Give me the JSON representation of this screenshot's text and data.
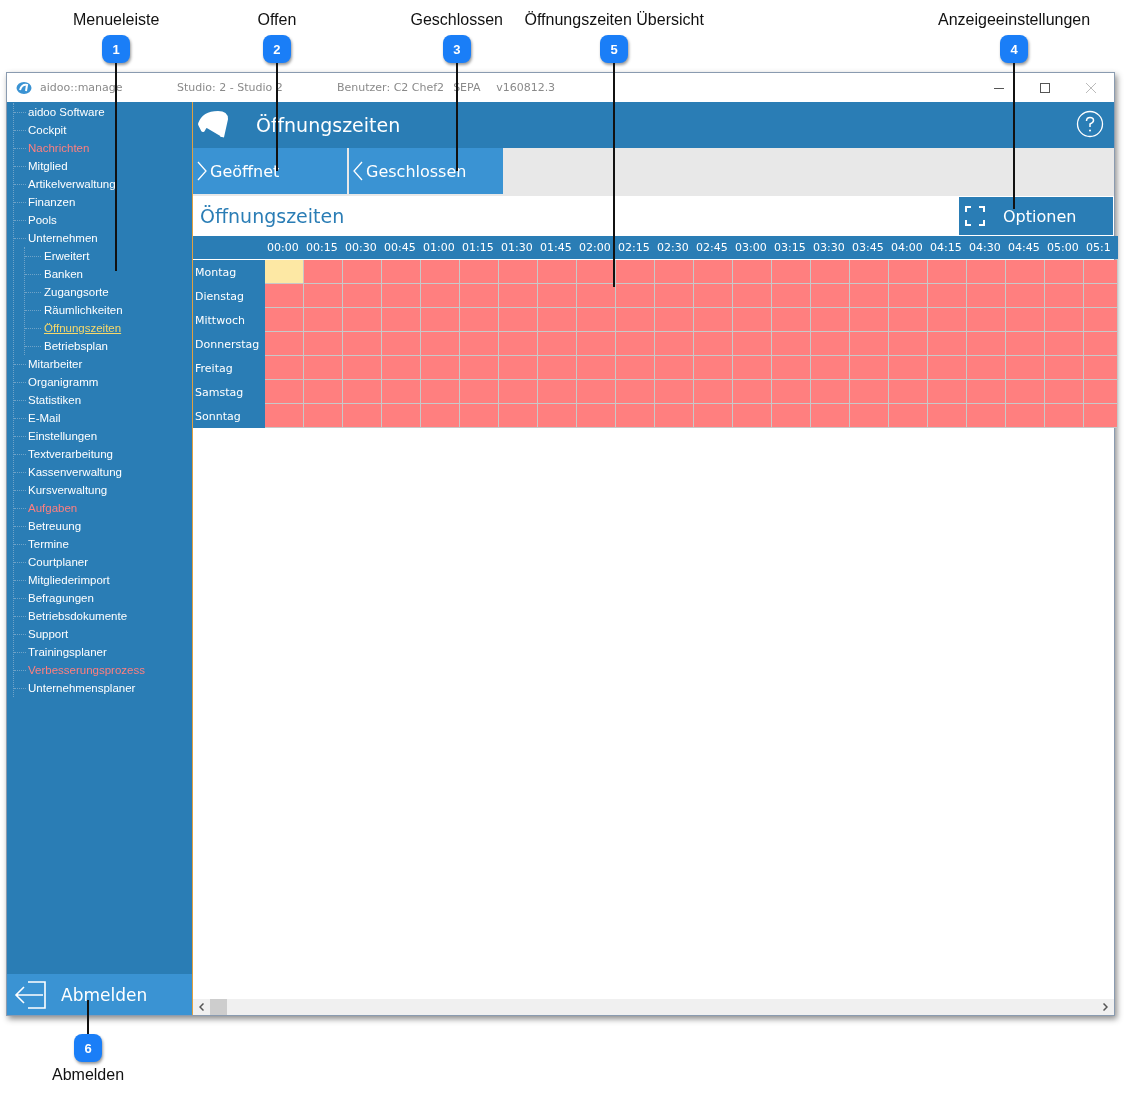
{
  "callouts": [
    {
      "number": "1",
      "label": "Menueleiste"
    },
    {
      "number": "2",
      "label": "Offen"
    },
    {
      "number": "3",
      "label": "Geschlossen"
    },
    {
      "number": "5",
      "label": "Öffnungszeiten Übersicht"
    },
    {
      "number": "4",
      "label": "Anzeigeeinstellungen"
    },
    {
      "number": "6",
      "label": "Abmelden"
    }
  ],
  "window": {
    "app": "aidoo::manage",
    "studio": "Studio: 2 - Studio 2",
    "user": "Benutzer: C2 Chef2",
    "mode": "SEPA",
    "version": "v160812.3"
  },
  "sidebar": {
    "items": [
      {
        "label": "aidoo Software",
        "color": "#ffffff",
        "selected": false
      },
      {
        "label": "Cockpit",
        "color": "#ffffff",
        "selected": false
      },
      {
        "label": "Nachrichten",
        "color": "#ff7f7f",
        "selected": false
      },
      {
        "label": "Mitglied",
        "color": "#ffffff",
        "selected": false
      },
      {
        "label": "Artikelverwaltung",
        "color": "#ffffff",
        "selected": false
      },
      {
        "label": "Finanzen",
        "color": "#ffffff",
        "selected": false
      },
      {
        "label": "Pools",
        "color": "#ffffff",
        "selected": false
      },
      {
        "label": "Unternehmen",
        "color": "#ffffff",
        "selected": false,
        "children": [
          {
            "label": "Erweitert",
            "color": "#ffffff",
            "selected": false
          },
          {
            "label": "Banken",
            "color": "#ffffff",
            "selected": false
          },
          {
            "label": "Zugangsorte",
            "color": "#ffffff",
            "selected": false
          },
          {
            "label": "Räumlichkeiten",
            "color": "#ffffff",
            "selected": false
          },
          {
            "label": "Öffnungszeiten",
            "color": "#f6d86b",
            "selected": true
          },
          {
            "label": "Betriebsplan",
            "color": "#ffffff",
            "selected": false
          }
        ]
      },
      {
        "label": "Mitarbeiter",
        "color": "#ffffff",
        "selected": false
      },
      {
        "label": "Organigramm",
        "color": "#ffffff",
        "selected": false
      },
      {
        "label": "Statistiken",
        "color": "#ffffff",
        "selected": false
      },
      {
        "label": "E-Mail",
        "color": "#ffffff",
        "selected": false
      },
      {
        "label": "Einstellungen",
        "color": "#ffffff",
        "selected": false
      },
      {
        "label": "Textverarbeitung",
        "color": "#ffffff",
        "selected": false
      },
      {
        "label": "Kassenverwaltung",
        "color": "#ffffff",
        "selected": false
      },
      {
        "label": "Kursverwaltung",
        "color": "#ffffff",
        "selected": false
      },
      {
        "label": "Aufgaben",
        "color": "#ff7f7f",
        "selected": false
      },
      {
        "label": "Betreuung",
        "color": "#ffffff",
        "selected": false
      },
      {
        "label": "Termine",
        "color": "#ffffff",
        "selected": false
      },
      {
        "label": "Courtplaner",
        "color": "#ffffff",
        "selected": false
      },
      {
        "label": "Mitgliederimport",
        "color": "#ffffff",
        "selected": false
      },
      {
        "label": "Befragungen",
        "color": "#ffffff",
        "selected": false
      },
      {
        "label": "Betriebsdokumente",
        "color": "#ffffff",
        "selected": false
      },
      {
        "label": "Support",
        "color": "#ffffff",
        "selected": false
      },
      {
        "label": "Trainingsplaner",
        "color": "#ffffff",
        "selected": false
      },
      {
        "label": "Verbesserungsprozess",
        "color": "#ff7f7f",
        "selected": false
      },
      {
        "label": "Unternehmensplaner",
        "color": "#ffffff",
        "selected": false
      }
    ],
    "logout": "Abmelden"
  },
  "header": {
    "title": "Öffnungszeiten"
  },
  "actions": [
    "Geöffnet",
    "Geschlossen"
  ],
  "section": {
    "title": "Öffnungszeiten",
    "options": "Optionen"
  },
  "schedule": {
    "times": [
      "00:00",
      "00:15",
      "00:30",
      "00:45",
      "01:00",
      "01:15",
      "01:30",
      "01:45",
      "02:00",
      "02:15",
      "02:30",
      "02:45",
      "03:00",
      "03:15",
      "03:30",
      "03:45",
      "04:00",
      "04:15",
      "04:30",
      "04:45",
      "05:00",
      "05:1"
    ],
    "days": [
      {
        "label": "Montag",
        "slots": [
          {
            "selected": true
          },
          {
            "selected": false
          },
          {
            "selected": false
          },
          {
            "selected": false
          },
          {
            "selected": false
          },
          {
            "selected": false
          },
          {
            "selected": false
          },
          {
            "selected": false
          },
          {
            "selected": false
          },
          {
            "selected": false
          },
          {
            "selected": false
          },
          {
            "selected": false
          },
          {
            "selected": false
          },
          {
            "selected": false
          },
          {
            "selected": false
          },
          {
            "selected": false
          },
          {
            "selected": false
          },
          {
            "selected": false
          },
          {
            "selected": false
          },
          {
            "selected": false
          },
          {
            "selected": false
          },
          {
            "selected": false
          }
        ]
      },
      {
        "label": "Dienstag",
        "slots": [
          {
            "selected": false
          },
          {
            "selected": false
          },
          {
            "selected": false
          },
          {
            "selected": false
          },
          {
            "selected": false
          },
          {
            "selected": false
          },
          {
            "selected": false
          },
          {
            "selected": false
          },
          {
            "selected": false
          },
          {
            "selected": false
          },
          {
            "selected": false
          },
          {
            "selected": false
          },
          {
            "selected": false
          },
          {
            "selected": false
          },
          {
            "selected": false
          },
          {
            "selected": false
          },
          {
            "selected": false
          },
          {
            "selected": false
          },
          {
            "selected": false
          },
          {
            "selected": false
          },
          {
            "selected": false
          },
          {
            "selected": false
          }
        ]
      },
      {
        "label": "Mittwoch",
        "slots": [
          {
            "selected": false
          },
          {
            "selected": false
          },
          {
            "selected": false
          },
          {
            "selected": false
          },
          {
            "selected": false
          },
          {
            "selected": false
          },
          {
            "selected": false
          },
          {
            "selected": false
          },
          {
            "selected": false
          },
          {
            "selected": false
          },
          {
            "selected": false
          },
          {
            "selected": false
          },
          {
            "selected": false
          },
          {
            "selected": false
          },
          {
            "selected": false
          },
          {
            "selected": false
          },
          {
            "selected": false
          },
          {
            "selected": false
          },
          {
            "selected": false
          },
          {
            "selected": false
          },
          {
            "selected": false
          },
          {
            "selected": false
          }
        ]
      },
      {
        "label": "Donnerstag",
        "slots": [
          {
            "selected": false
          },
          {
            "selected": false
          },
          {
            "selected": false
          },
          {
            "selected": false
          },
          {
            "selected": false
          },
          {
            "selected": false
          },
          {
            "selected": false
          },
          {
            "selected": false
          },
          {
            "selected": false
          },
          {
            "selected": false
          },
          {
            "selected": false
          },
          {
            "selected": false
          },
          {
            "selected": false
          },
          {
            "selected": false
          },
          {
            "selected": false
          },
          {
            "selected": false
          },
          {
            "selected": false
          },
          {
            "selected": false
          },
          {
            "selected": false
          },
          {
            "selected": false
          },
          {
            "selected": false
          },
          {
            "selected": false
          }
        ]
      },
      {
        "label": "Freitag",
        "slots": [
          {
            "selected": false
          },
          {
            "selected": false
          },
          {
            "selected": false
          },
          {
            "selected": false
          },
          {
            "selected": false
          },
          {
            "selected": false
          },
          {
            "selected": false
          },
          {
            "selected": false
          },
          {
            "selected": false
          },
          {
            "selected": false
          },
          {
            "selected": false
          },
          {
            "selected": false
          },
          {
            "selected": false
          },
          {
            "selected": false
          },
          {
            "selected": false
          },
          {
            "selected": false
          },
          {
            "selected": false
          },
          {
            "selected": false
          },
          {
            "selected": false
          },
          {
            "selected": false
          },
          {
            "selected": false
          },
          {
            "selected": false
          }
        ]
      },
      {
        "label": "Samstag",
        "slots": [
          {
            "selected": false
          },
          {
            "selected": false
          },
          {
            "selected": false
          },
          {
            "selected": false
          },
          {
            "selected": false
          },
          {
            "selected": false
          },
          {
            "selected": false
          },
          {
            "selected": false
          },
          {
            "selected": false
          },
          {
            "selected": false
          },
          {
            "selected": false
          },
          {
            "selected": false
          },
          {
            "selected": false
          },
          {
            "selected": false
          },
          {
            "selected": false
          },
          {
            "selected": false
          },
          {
            "selected": false
          },
          {
            "selected": false
          },
          {
            "selected": false
          },
          {
            "selected": false
          },
          {
            "selected": false
          },
          {
            "selected": false
          }
        ]
      },
      {
        "label": "Sonntag",
        "slots": [
          {
            "selected": false
          },
          {
            "selected": false
          },
          {
            "selected": false
          },
          {
            "selected": false
          },
          {
            "selected": false
          },
          {
            "selected": false
          },
          {
            "selected": false
          },
          {
            "selected": false
          },
          {
            "selected": false
          },
          {
            "selected": false
          },
          {
            "selected": false
          },
          {
            "selected": false
          },
          {
            "selected": false
          },
          {
            "selected": false
          },
          {
            "selected": false
          },
          {
            "selected": false
          },
          {
            "selected": false
          },
          {
            "selected": false
          },
          {
            "selected": false
          },
          {
            "selected": false
          },
          {
            "selected": false
          },
          {
            "selected": false
          }
        ]
      }
    ]
  }
}
